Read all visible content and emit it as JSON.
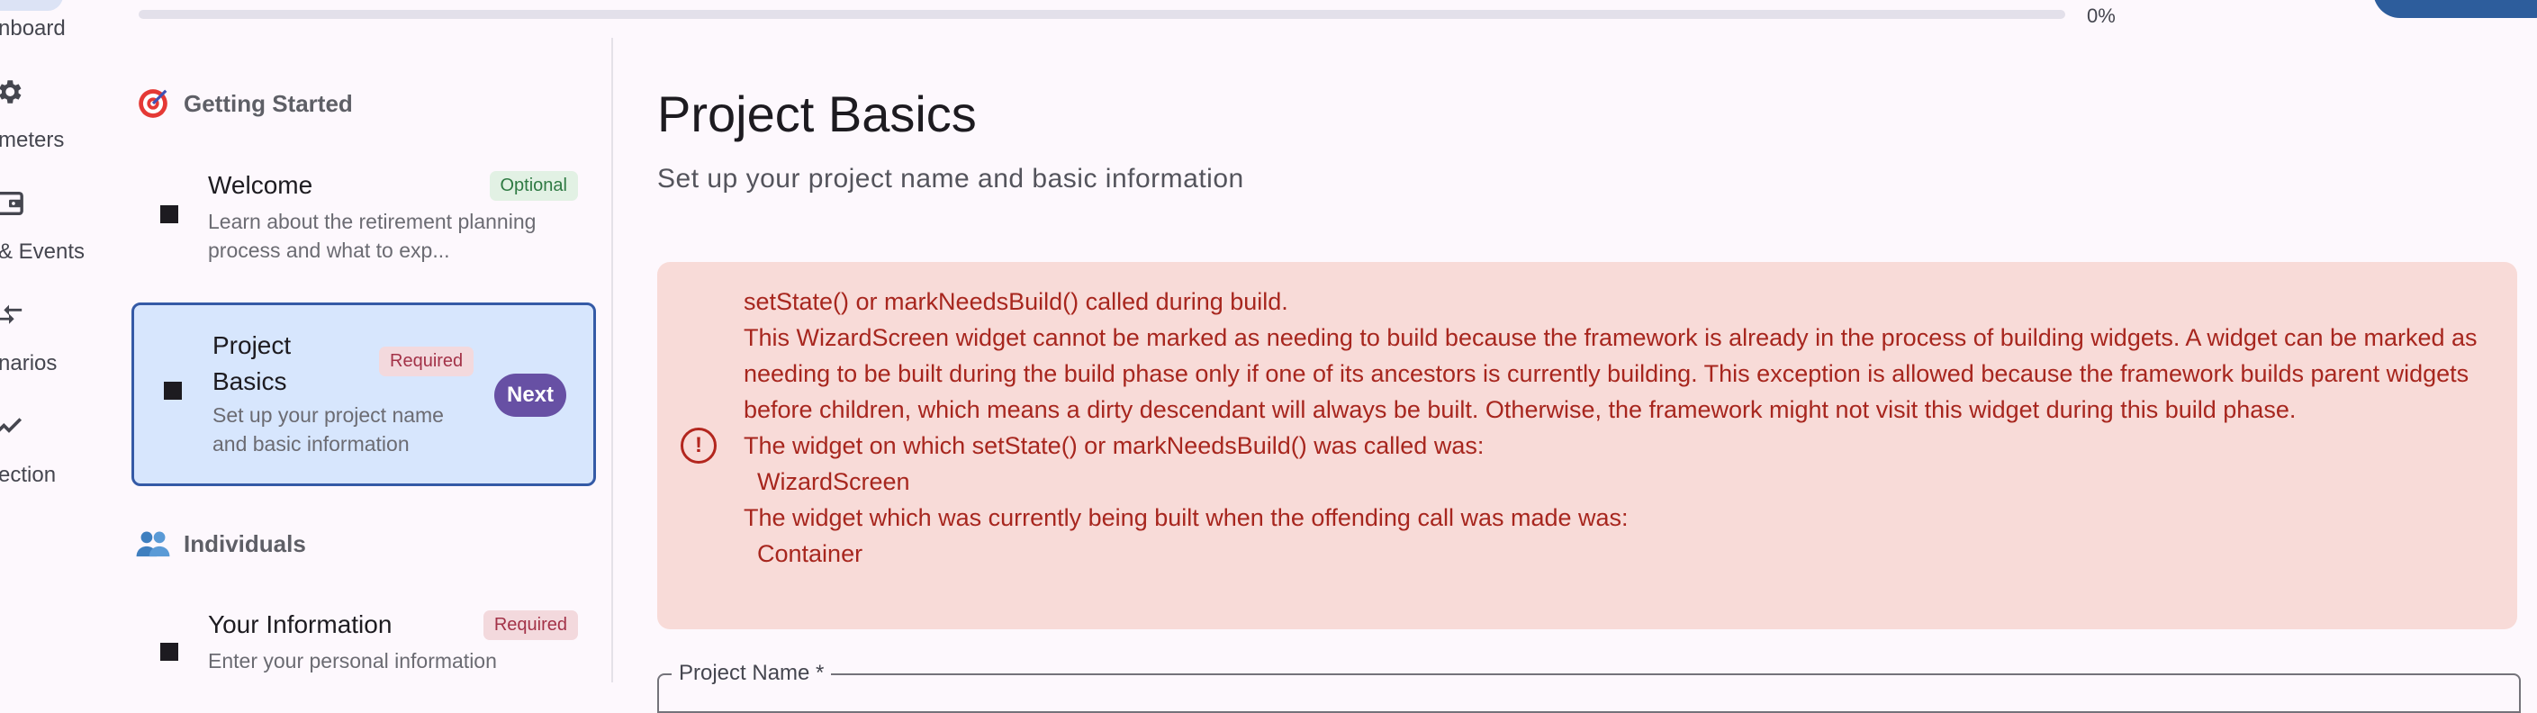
{
  "nav_rail": {
    "items": [
      {
        "label": "nboard",
        "icon": "dashboard-icon"
      },
      {
        "label": "meters",
        "icon": "gear-icon"
      },
      {
        "label": "& Events",
        "icon": "wallet-icon"
      },
      {
        "label": "narios",
        "icon": "compare-arrows-icon"
      },
      {
        "label": "ection",
        "icon": "trending-up-icon"
      }
    ]
  },
  "progress": {
    "value": 0,
    "label": "0%"
  },
  "steps": {
    "sections": [
      {
        "title": "Getting Started",
        "icon": "target-icon"
      },
      {
        "title": "Individuals",
        "icon": "people-icon"
      }
    ],
    "items": [
      {
        "title": "Welcome",
        "description": "Learn about the retirement planning process and what to exp...",
        "badge": "Optional"
      },
      {
        "title": "Project Basics",
        "description": "Set up your project name and basic information",
        "badge": "Required",
        "action": "Next"
      },
      {
        "title": "Your Information",
        "description": "Enter your personal information",
        "badge": "Required"
      }
    ]
  },
  "main": {
    "title": "Project Basics",
    "subtitle": "Set up your project name and basic information",
    "error": {
      "icon": "error-circle-icon",
      "lines": [
        "setState() or markNeedsBuild() called during build.",
        "This WizardScreen widget cannot be marked as needing to build because the framework is already in the process of building widgets. A widget can be marked as needing to be built during the build phase only if one of its ancestors is currently building. This exception is allowed because the framework builds parent widgets before children, which means a dirty descendant will always be built. Otherwise, the framework might not visit this widget during this build phase.",
        "The widget on which setState() or markNeedsBuild() was called was:",
        "WizardScreen",
        "The widget which was currently being built when the offending call was made was:",
        "Container"
      ]
    },
    "project_name_label": "Project Name *"
  }
}
